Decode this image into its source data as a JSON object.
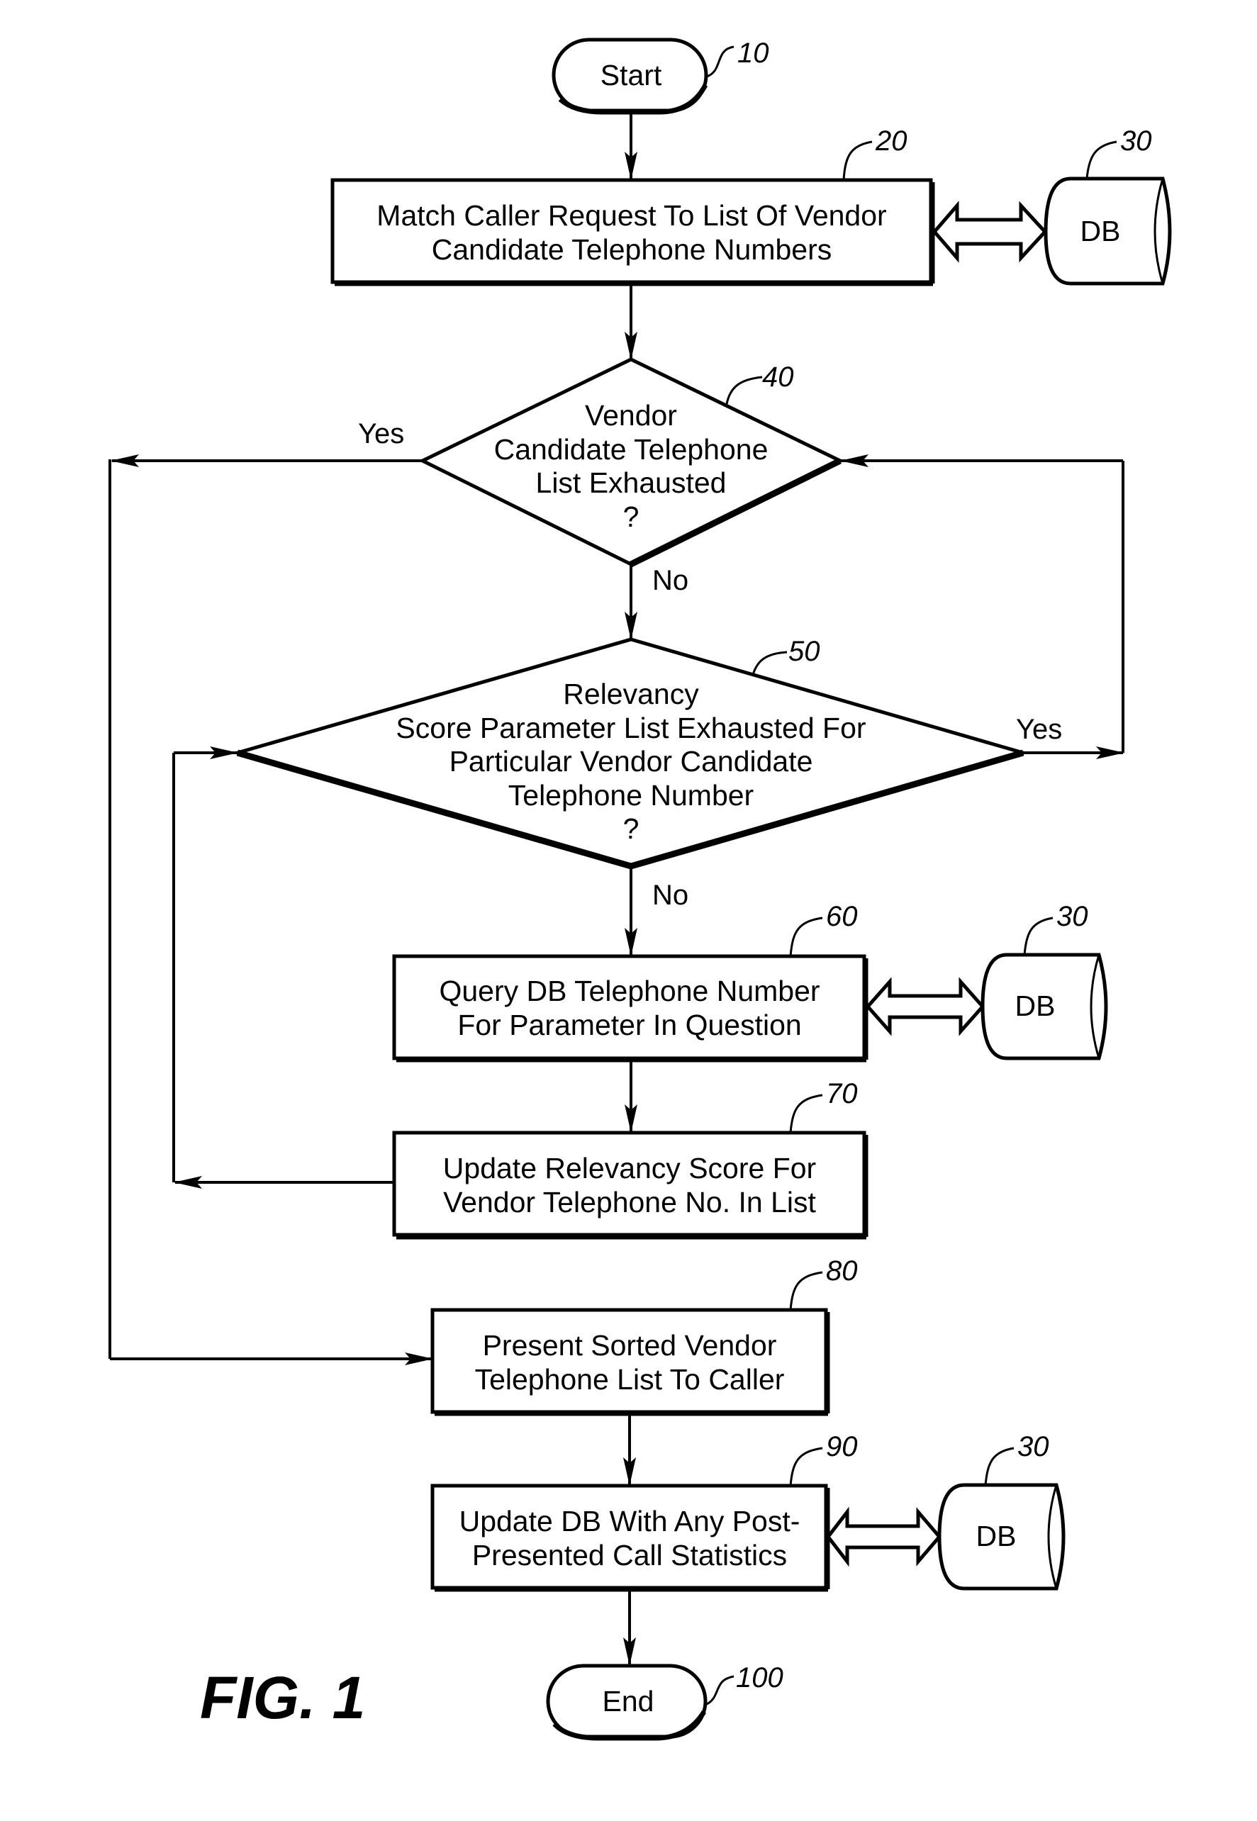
{
  "figure": {
    "label": "FIG. 1",
    "nodes": {
      "start": {
        "text": "Start",
        "ref": "10"
      },
      "match": {
        "lines": [
          "Match Caller Request To List Of Vendor",
          "Candidate Telephone Numbers"
        ],
        "ref": "20"
      },
      "db_top": {
        "text": "DB",
        "ref": "30"
      },
      "decision_list": {
        "lines": [
          "Vendor",
          "Candidate Telephone",
          "List Exhausted",
          "?"
        ],
        "ref": "40"
      },
      "decision_params": {
        "lines": [
          "Relevancy",
          "Score Parameter List Exhausted For",
          "Particular Vendor Candidate",
          "Telephone Number",
          "?"
        ],
        "ref": "50"
      },
      "query": {
        "lines": [
          "Query DB Telephone Number",
          "For Parameter In Question"
        ],
        "ref": "60"
      },
      "db_mid": {
        "text": "DB",
        "ref": "30"
      },
      "update_score": {
        "lines": [
          "Update Relevancy Score For",
          "Vendor Telephone No. In List"
        ],
        "ref": "70"
      },
      "present": {
        "lines": [
          "Present Sorted Vendor",
          "Telephone List To Caller"
        ],
        "ref": "80"
      },
      "update_db": {
        "lines": [
          "Update DB With Any Post-",
          "Presented Call Statistics"
        ],
        "ref": "90"
      },
      "db_bottom": {
        "text": "DB",
        "ref": "30"
      },
      "end": {
        "text": "End",
        "ref": "100"
      }
    },
    "edges": {
      "d40_yes": "Yes",
      "d40_no": "No",
      "d50_yes": "Yes",
      "d50_no": "No"
    }
  }
}
